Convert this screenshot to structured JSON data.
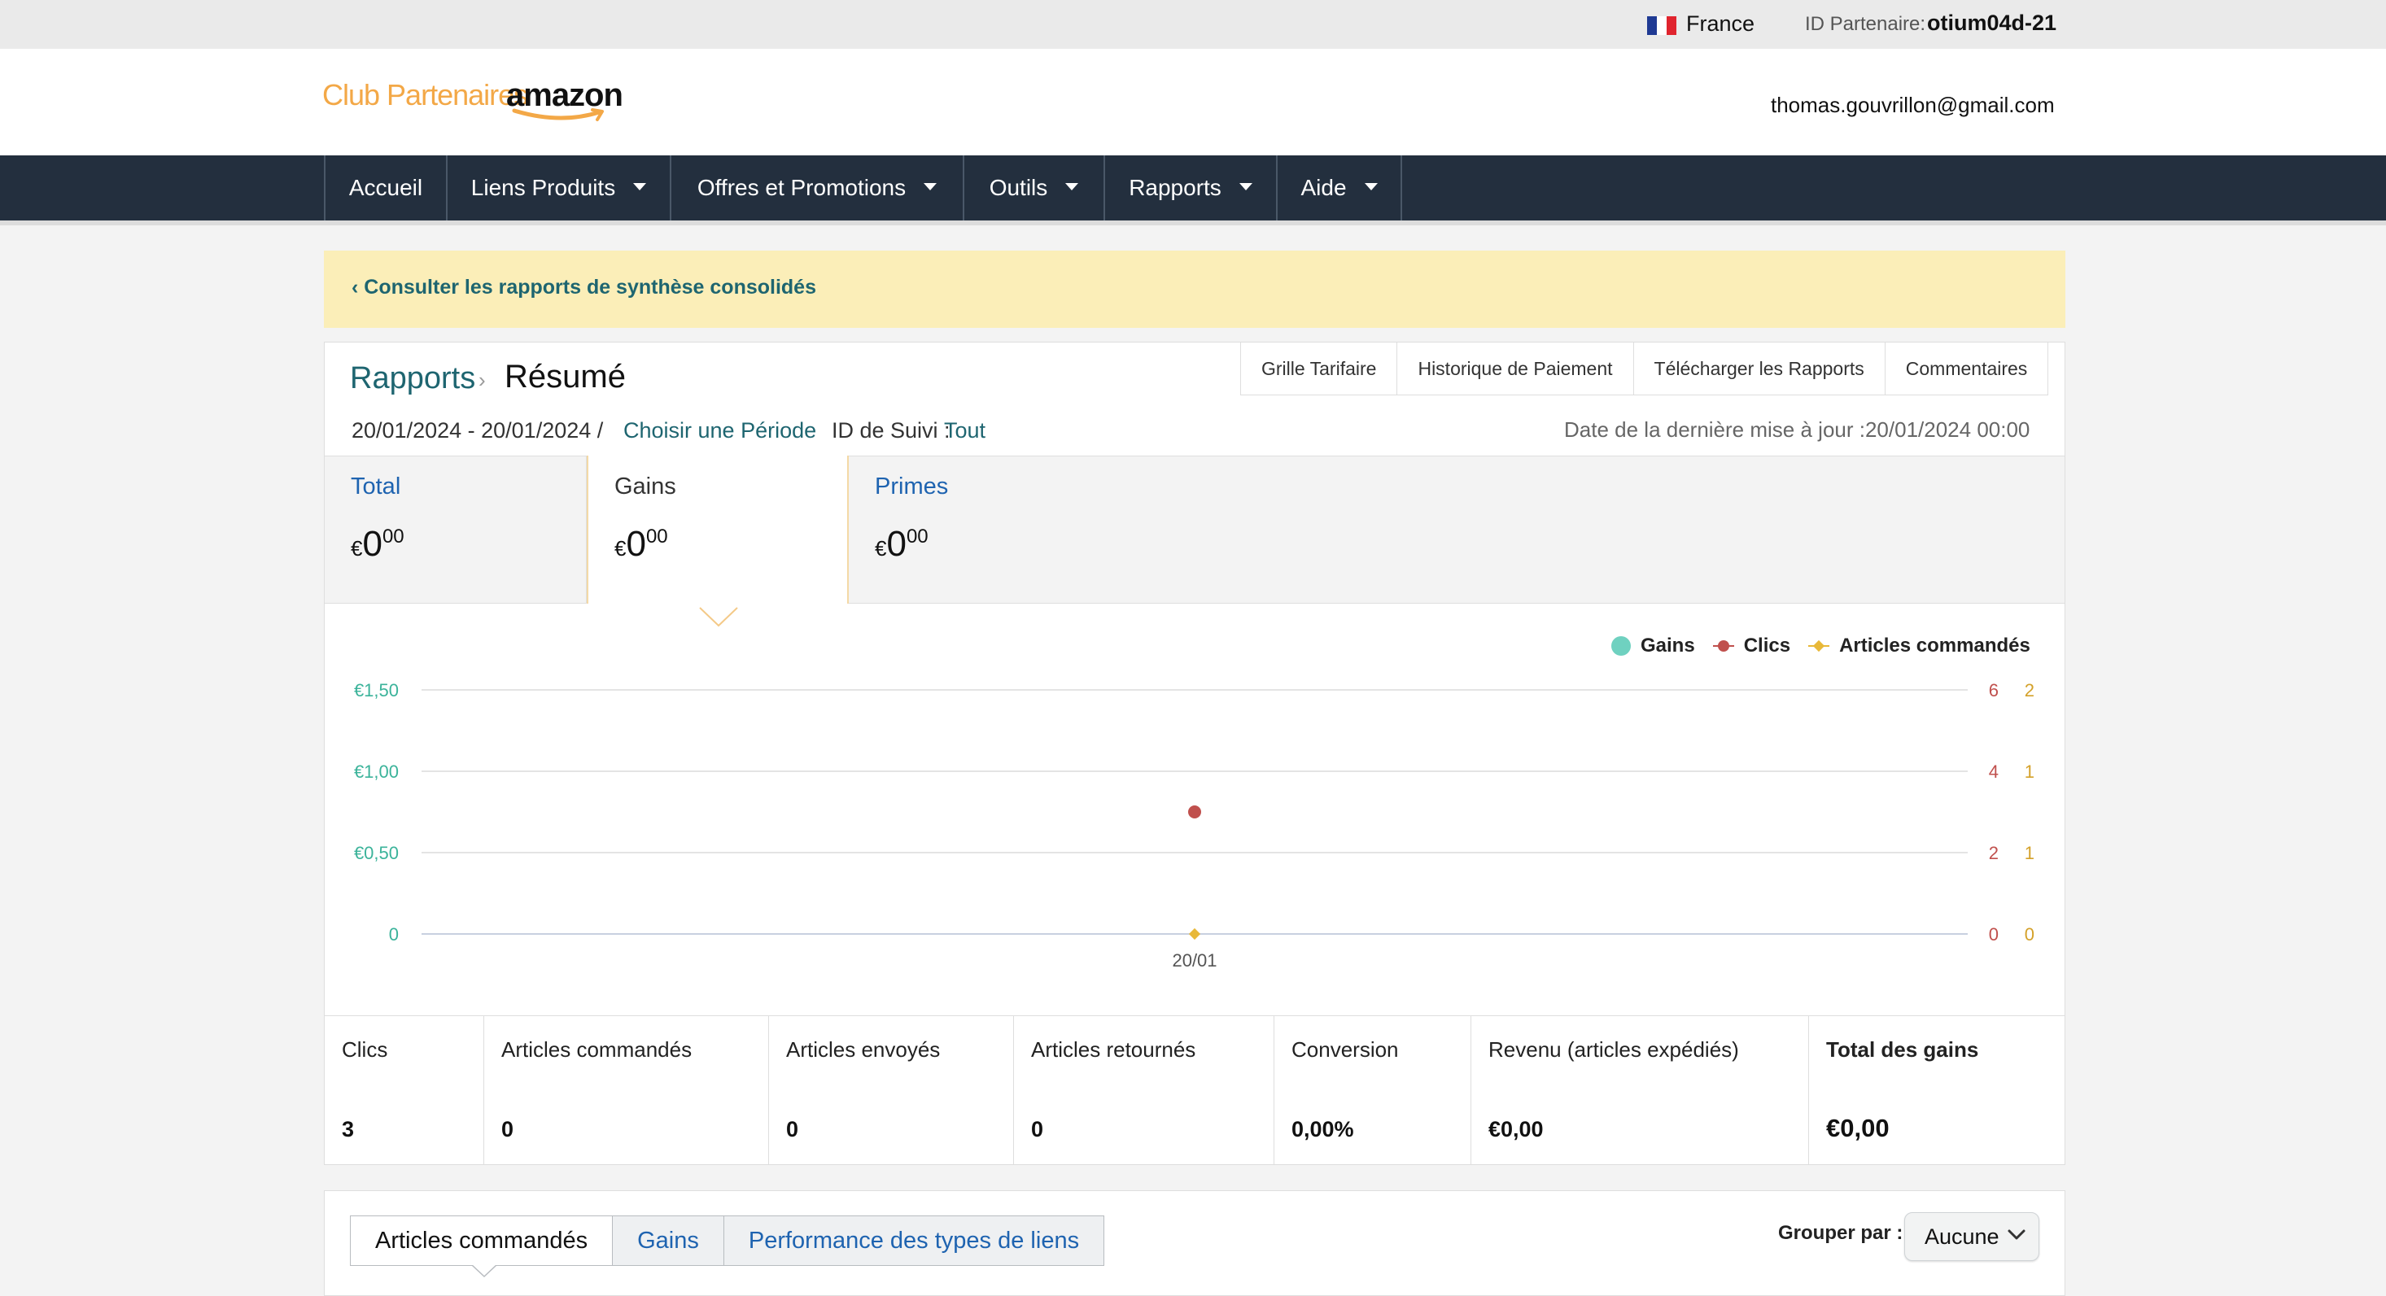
{
  "topbar": {
    "country": "France",
    "partner_id_label": "ID Partenaire:",
    "partner_id": "otium04d-21"
  },
  "header": {
    "logo_club": "Club Partenaires",
    "logo_brand": "amazon",
    "user_email": "thomas.gouvrillon@gmail.com"
  },
  "nav": {
    "items": [
      {
        "label": "Accueil"
      },
      {
        "label": "Liens Produits"
      },
      {
        "label": "Offres et Promotions"
      },
      {
        "label": "Outils"
      },
      {
        "label": "Rapports"
      },
      {
        "label": "Aide"
      }
    ]
  },
  "banner": {
    "link": "‹ Consulter les rapports de synthèse consolidés"
  },
  "breadcrumb": {
    "parent": "Rapports",
    "separator": "›",
    "current": "Résumé"
  },
  "report_tabs": [
    "Grille Tarifaire",
    "Historique de Paiement",
    "Télécharger les Rapports",
    "Commentaires"
  ],
  "filters": {
    "date_range": "20/01/2024 - 20/01/2024 /",
    "choose_period": "Choisir une Période",
    "tracking_label": "ID de Suivi :",
    "tracking_value": "Tout",
    "last_update": "Date de la dernière mise à jour :20/01/2024 00:00"
  },
  "summary": [
    {
      "label": "Total",
      "currency": "€",
      "int": "0",
      "dec": "00"
    },
    {
      "label": "Gains",
      "currency": "€",
      "int": "0",
      "dec": "00"
    },
    {
      "label": "Primes",
      "currency": "€",
      "int": "0",
      "dec": "00"
    }
  ],
  "chart_data": {
    "type": "line",
    "categories": [
      "20/01"
    ],
    "series": [
      {
        "name": "Gains",
        "values": [
          0
        ],
        "axis": "left",
        "color": "#6fd1c0"
      },
      {
        "name": "Clics",
        "values": [
          3
        ],
        "axis": "right-1",
        "color": "#c0504d"
      },
      {
        "name": "Articles commandés",
        "values": [
          0
        ],
        "axis": "right-2",
        "color": "#e8b838"
      }
    ],
    "y_left_ticks": [
      "0",
      "€0,50",
      "€1,00",
      "€1,50"
    ],
    "y_left_range": [
      0,
      1.5
    ],
    "y_right1_ticks": [
      "0",
      "2",
      "4",
      "6"
    ],
    "y_right1_range": [
      0,
      6
    ],
    "y_right2_ticks": [
      "0",
      "1",
      "1",
      "2"
    ],
    "legend_position": "top-right",
    "grid": true
  },
  "metrics": [
    {
      "label": "Clics",
      "value": "3"
    },
    {
      "label": "Articles commandés",
      "value": "0"
    },
    {
      "label": "Articles envoyés",
      "value": "0"
    },
    {
      "label": "Articles retournés",
      "value": "0"
    },
    {
      "label": "Conversion",
      "value": "0,00%"
    },
    {
      "label": "Revenu (articles expédiés)",
      "value": "€0,00"
    },
    {
      "label": "Total des gains",
      "value": "€0,00"
    }
  ],
  "bottom_tabs": [
    "Articles commandés",
    "Gains",
    "Performance des types de liens"
  ],
  "group_by": {
    "label": "Grouper par :",
    "value": "Aucune"
  },
  "colors": {
    "nav_bg": "#232f3e",
    "link": "#1e6570",
    "accent": "#f3a847",
    "banner_bg": "#fbeeb8"
  }
}
